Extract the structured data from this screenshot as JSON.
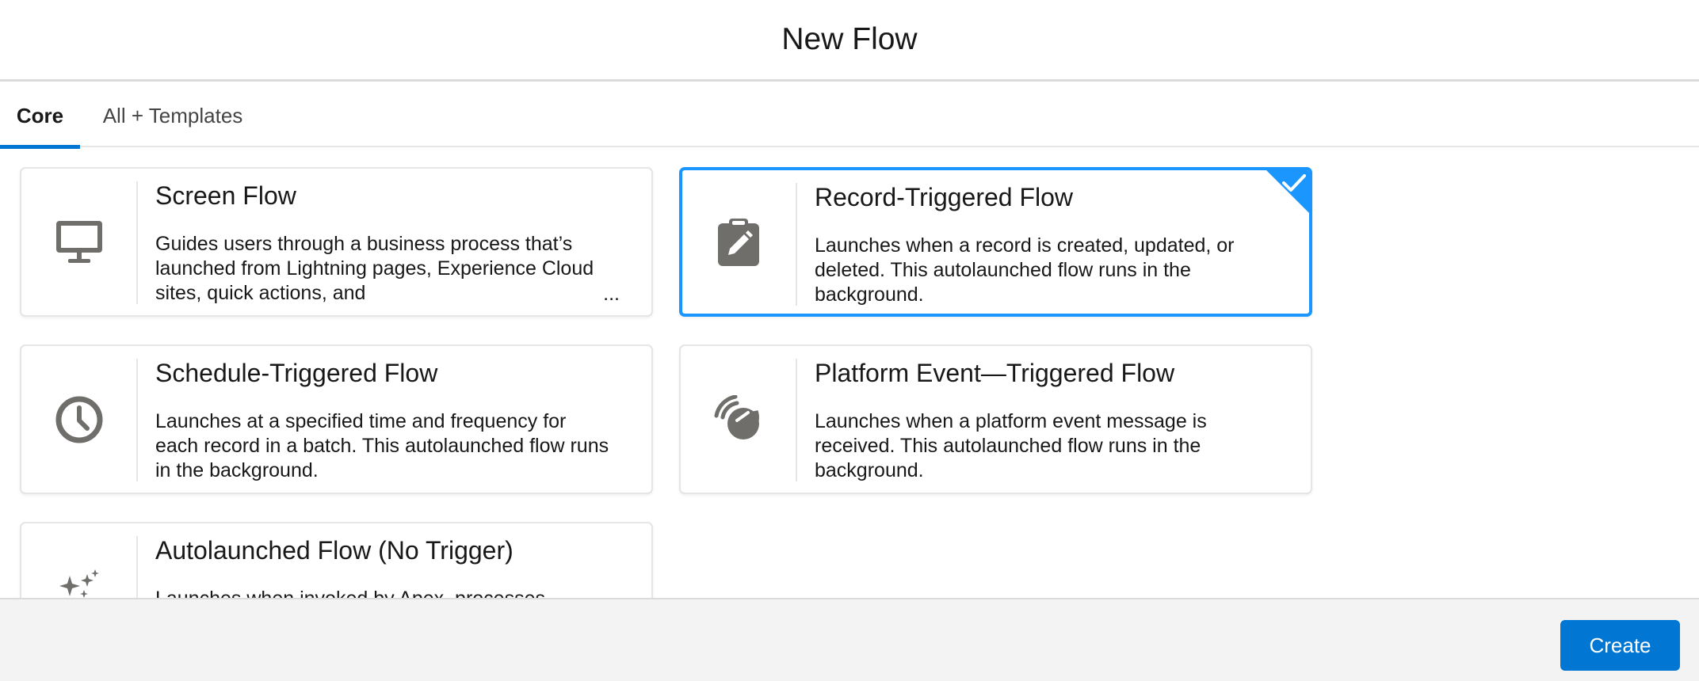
{
  "header": {
    "title": "New Flow"
  },
  "tabs": [
    {
      "label": "Core",
      "active": true
    },
    {
      "label": "All + Templates",
      "active": false
    }
  ],
  "cards": [
    {
      "title": "Screen Flow",
      "description": "Guides users through a business process that’s launched from Lightning pages, Experience Cloud sites, quick actions, and",
      "more": "...",
      "icon": "desktop-icon",
      "selected": false
    },
    {
      "title": "Record-Triggered Flow",
      "description": "Launches when a record is created, updated, or deleted. This autolaunched flow runs in the background.",
      "icon": "clipboard-edit-icon",
      "selected": true
    },
    {
      "title": "Schedule-Triggered Flow",
      "description": "Launches at a specified time and frequency for each record in a batch. This autolaunched flow runs in the background.",
      "icon": "clock-icon",
      "selected": false
    },
    {
      "title": "Platform Event—Triggered Flow",
      "description": "Launches when a platform event message is received. This autolaunched flow runs in the background.",
      "icon": "broadcast-icon",
      "selected": false
    },
    {
      "title": "Autolaunched Flow (No Trigger)",
      "description": "Launches when invoked by Apex, processes",
      "icon": "sparkles-icon",
      "selected": false
    }
  ],
  "footer": {
    "create_label": "Create"
  },
  "colors": {
    "brand": "#0176d3",
    "selected_border": "#1b96ff",
    "icon": "#706e6b"
  }
}
